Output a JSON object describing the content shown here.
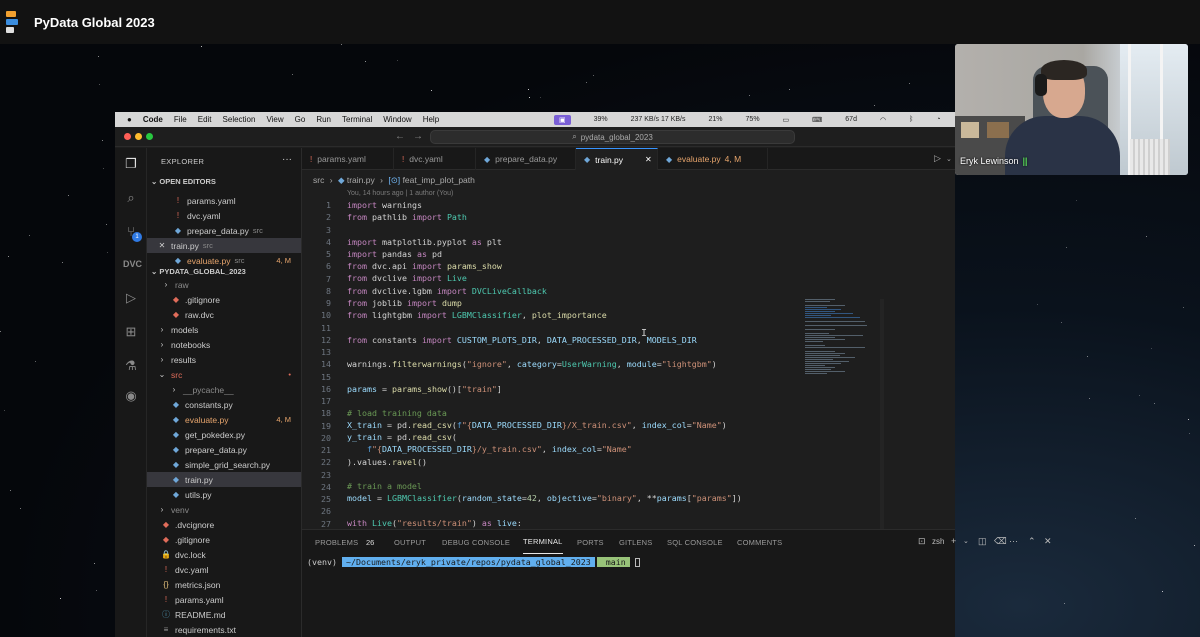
{
  "conference": {
    "title": "PyData Global 2023"
  },
  "menubar": {
    "app": "Code",
    "items": [
      "File",
      "Edit",
      "Selection",
      "View",
      "Go",
      "Run",
      "Terminal",
      "Window",
      "Help"
    ],
    "stats": [
      "39%",
      "237 KB/s 17 KB/s",
      "21%",
      "75%",
      "67d"
    ]
  },
  "titlebar": {
    "command_center": "pydata_global_2023"
  },
  "explorer": {
    "title": "EXPLORER",
    "open_editors_label": "OPEN EDITORS",
    "open_editors": [
      {
        "name": "params.yaml",
        "sub": "",
        "status": ""
      },
      {
        "name": "dvc.yaml",
        "sub": "",
        "status": ""
      },
      {
        "name": "prepare_data.py",
        "sub": "src",
        "status": ""
      },
      {
        "name": "train.py",
        "sub": "src",
        "status": ""
      },
      {
        "name": "evaluate.py",
        "sub": "src",
        "status": "4, M"
      }
    ],
    "project_label": "PYDATA_GLOBAL_2023",
    "tree": [
      {
        "name": "raw",
        "status": ""
      },
      {
        "name": ".gitignore",
        "status": ""
      },
      {
        "name": "raw.dvc",
        "status": ""
      },
      {
        "name": "models",
        "status": ""
      },
      {
        "name": "notebooks",
        "status": ""
      },
      {
        "name": "results",
        "status": ""
      },
      {
        "name": "src",
        "status": "•"
      },
      {
        "name": "__pycache__",
        "status": ""
      },
      {
        "name": "constants.py",
        "status": ""
      },
      {
        "name": "evaluate.py",
        "status": "4, M"
      },
      {
        "name": "get_pokedex.py",
        "status": ""
      },
      {
        "name": "prepare_data.py",
        "status": ""
      },
      {
        "name": "simple_grid_search.py",
        "status": ""
      },
      {
        "name": "train.py",
        "status": ""
      },
      {
        "name": "utils.py",
        "status": ""
      },
      {
        "name": "venv",
        "status": ""
      },
      {
        "name": ".dvcignore",
        "status": ""
      },
      {
        "name": ".gitignore",
        "status": ""
      },
      {
        "name": "dvc.lock",
        "status": ""
      },
      {
        "name": "dvc.yaml",
        "status": ""
      },
      {
        "name": "metrics.json",
        "status": ""
      },
      {
        "name": "params.yaml",
        "status": ""
      },
      {
        "name": "README.md",
        "status": ""
      },
      {
        "name": "requirements.txt",
        "status": ""
      }
    ],
    "scm_badge": "1"
  },
  "tabs": [
    {
      "name": "params.yaml",
      "status": ""
    },
    {
      "name": "dvc.yaml",
      "status": ""
    },
    {
      "name": "prepare_data.py",
      "status": ""
    },
    {
      "name": "train.py",
      "status": ""
    },
    {
      "name": "evaluate.py",
      "status": "4, M"
    }
  ],
  "breadcrumb": {
    "folder": "src",
    "file": "train.py",
    "symbol": "feat_imp_plot_path"
  },
  "blame": "You, 14 hours ago | 1 author (You)",
  "code_lines": [
    "1",
    "2",
    "3",
    "4",
    "5",
    "6",
    "7",
    "8",
    "9",
    "10",
    "11",
    "12",
    "13",
    "14",
    "15",
    "16",
    "17",
    "18",
    "19",
    "20",
    "21",
    "22",
    "23",
    "24",
    "25",
    "26",
    "27"
  ],
  "panel": {
    "tabs": [
      "PROBLEMS",
      "OUTPUT",
      "DEBUG CONSOLE",
      "TERMINAL",
      "PORTS",
      "GITLENS",
      "SQL CONSOLE",
      "COMMENTS"
    ],
    "problems_count": "26",
    "shell": "zsh",
    "terminal": {
      "env": "(venv)",
      "path": "~/Documents/eryk_private/repos/pydata_global_2023",
      "branch": "main"
    }
  },
  "webcam": {
    "name": "Eryk Lewinson",
    "audio_bars": "|||"
  }
}
